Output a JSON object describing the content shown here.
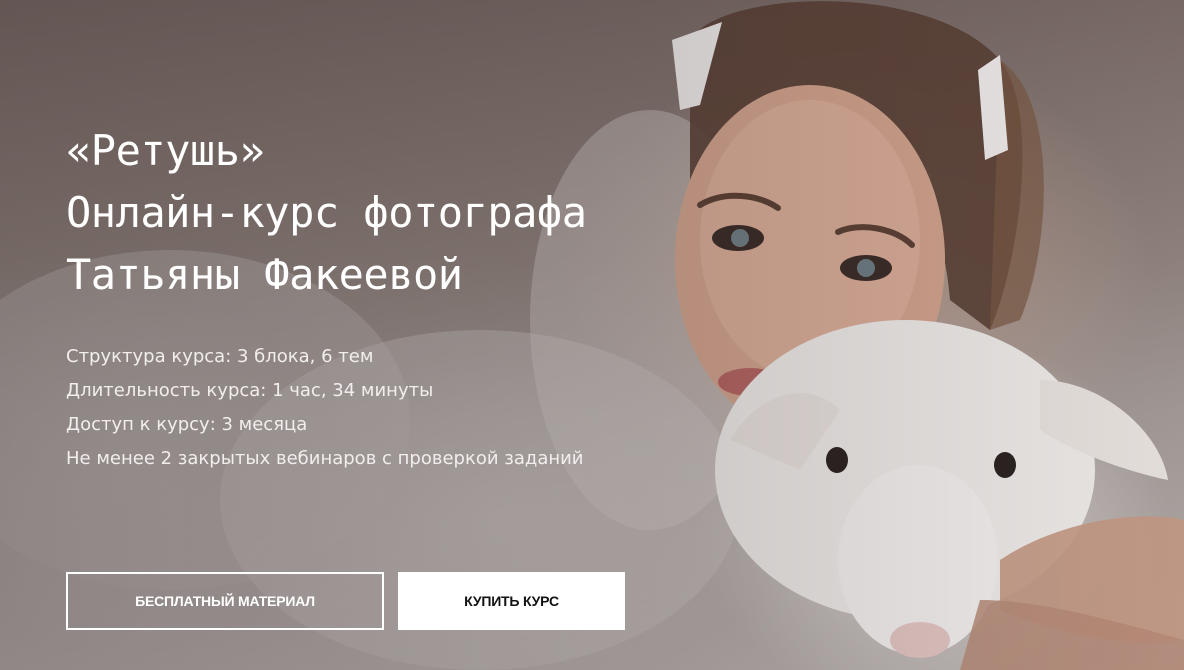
{
  "hero": {
    "title_lines": [
      "«Ретушь»",
      "Онлайн-курс фотографа",
      "Татьяны Факеевой"
    ],
    "facts": [
      "Структура курса: 3 блока, 6 тем",
      "Длительность курса: 1 час, 34 минуты",
      "Доступ к курсу: 3 месяца",
      "Не менее 2 закрытых вебинаров с проверкой заданий"
    ],
    "buttons": {
      "free_label": "БЕСПЛАТНЫЙ МАТЕРИАЛ",
      "buy_label": "КУПИТЬ КУРС"
    }
  },
  "colors": {
    "text": "#ffffff",
    "button_fill": "#ffffff",
    "button_text": "#111111"
  }
}
